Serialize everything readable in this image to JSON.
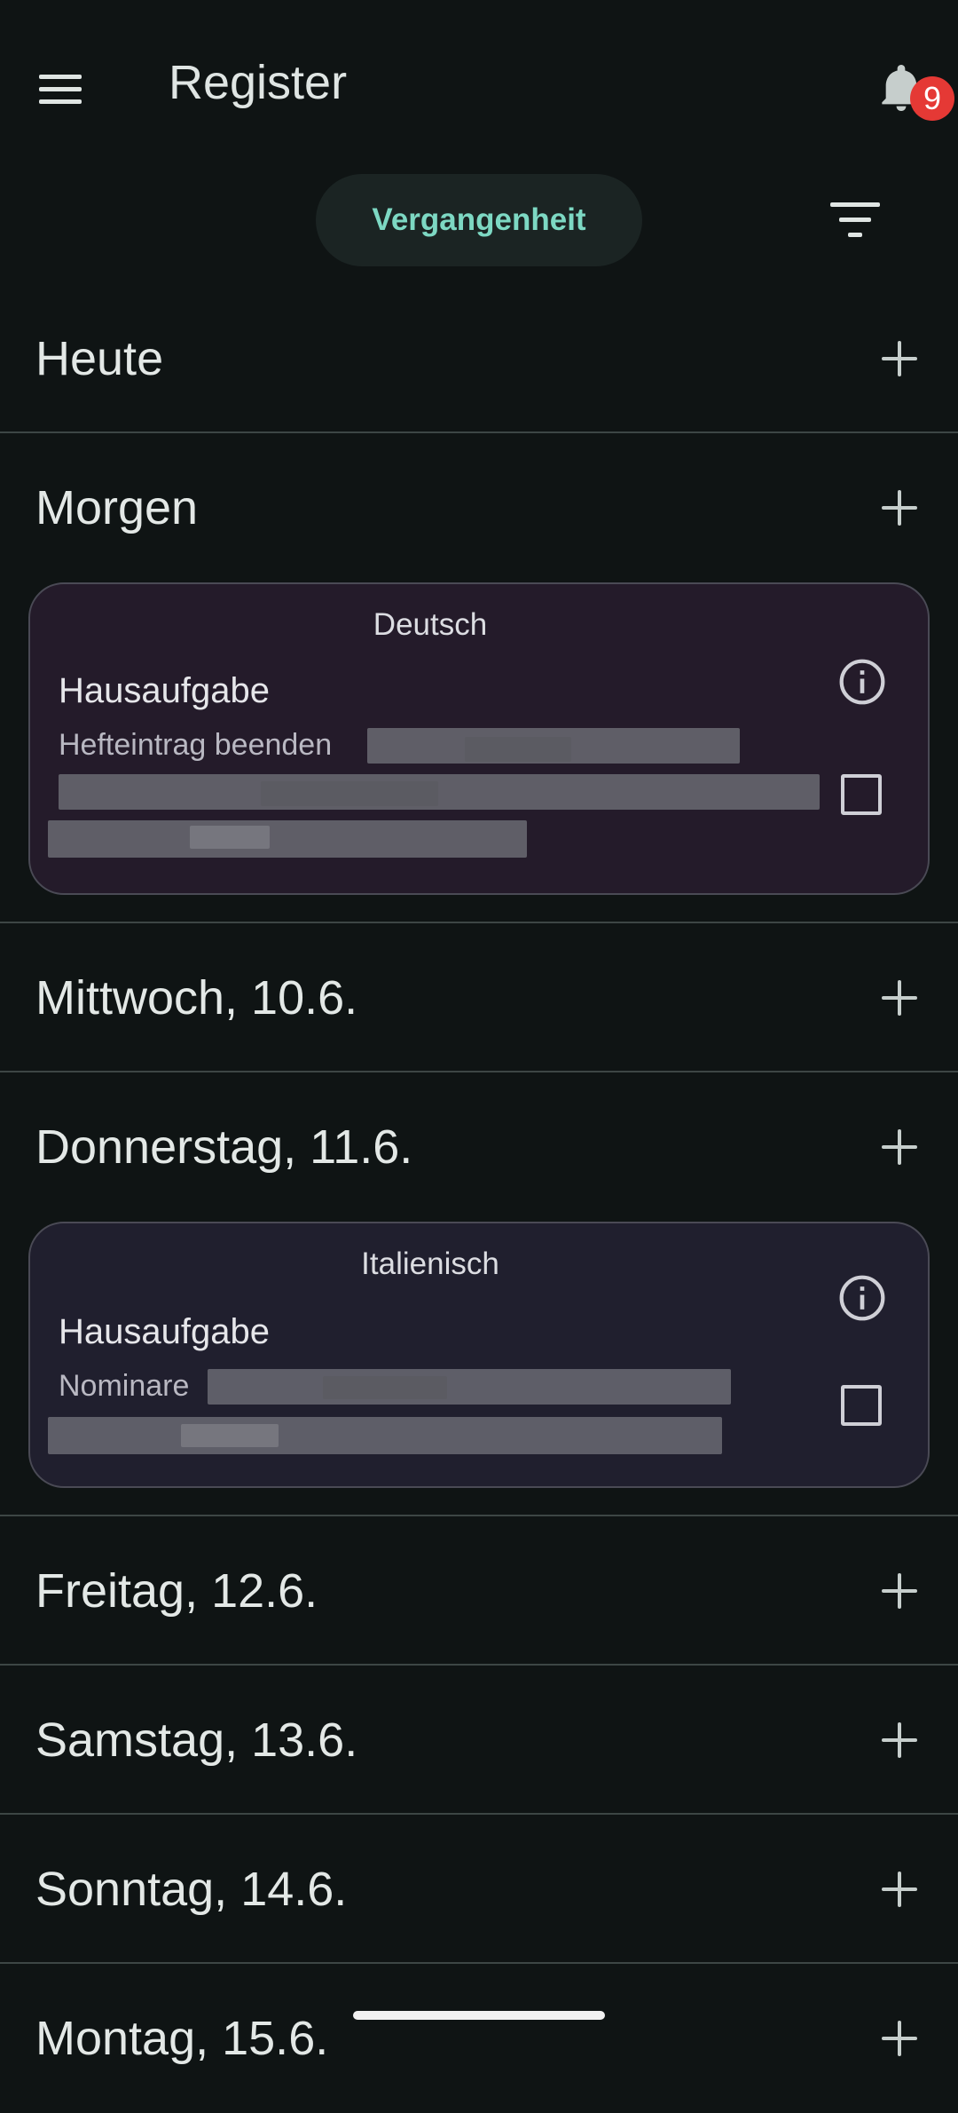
{
  "appbar": {
    "title": "Register",
    "menu_icon": "menu-icon",
    "bell_icon": "bell-icon",
    "notification_count": "9"
  },
  "filter_chip": {
    "label": "Vergangenheit"
  },
  "filter_icon": "filter-icon",
  "days": [
    {
      "label": "Heute"
    },
    {
      "label": "Morgen",
      "card": {
        "subject": "Deutsch",
        "type": "Hausaufgabe",
        "description": "Hefteintrag beenden"
      }
    },
    {
      "label": "Mittwoch, 10.6."
    },
    {
      "label": "Donnerstag, 11.6.",
      "card": {
        "subject": "Italienisch",
        "type": "Hausaufgabe",
        "description": "Nominare"
      }
    },
    {
      "label": "Freitag, 12.6."
    },
    {
      "label": "Samstag, 13.6."
    },
    {
      "label": "Sonntag, 14.6."
    },
    {
      "label": "Montag, 15.6."
    }
  ],
  "colors": {
    "background": "#0f1414",
    "accent": "#7dd8c3",
    "badge": "#e53935",
    "card_deutsch": "#241b2a",
    "card_italienisch": "#201f2e"
  }
}
